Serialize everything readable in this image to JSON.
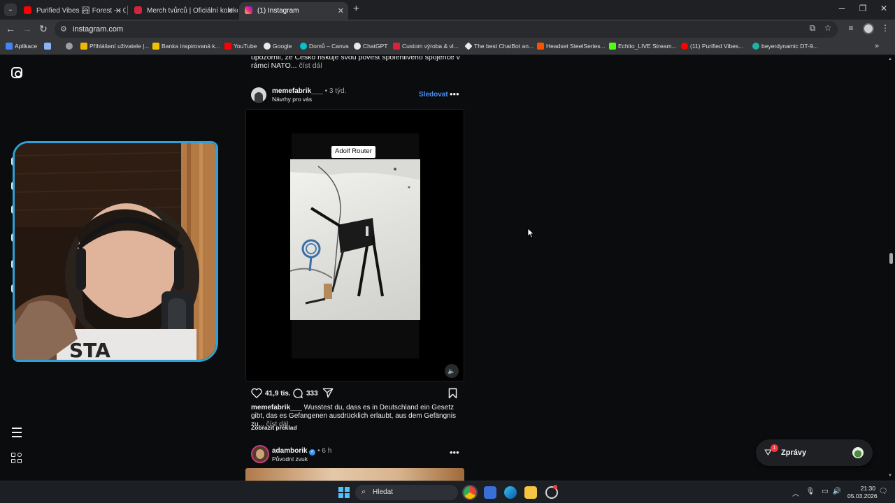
{
  "browser": {
    "tabs": [
      {
        "title": "Purified Vibes 🏞 Forest — Chi",
        "active": false,
        "favicon_color": "#ff0000"
      },
      {
        "title": "Merch tvůrců | Oficiální kolekce",
        "active": false,
        "favicon_color": "#d6233c"
      },
      {
        "title": "(1) Instagram",
        "active": true,
        "favicon_color": "#e1306c"
      }
    ],
    "url": "instagram.com",
    "bookmarks": [
      {
        "label": "Aplikace",
        "color": "#4285f4"
      },
      {
        "label": "",
        "color": "#8ab4f8"
      },
      {
        "label": "",
        "color": "#9aa0a6"
      },
      {
        "label": "Přihlášení uživatele |...",
        "color": "#f2b705"
      },
      {
        "label": "Banka inspirovaná k...",
        "color": "#f2c200"
      },
      {
        "label": "YouTube",
        "color": "#ff0000"
      },
      {
        "label": "Google",
        "color": "#e8eaed"
      },
      {
        "label": "Domů – Canva",
        "color": "#00c4cc"
      },
      {
        "label": "ChatGPT",
        "color": "#e8eaed"
      },
      {
        "label": "Custom výroba & vl...",
        "color": "#d6233c"
      },
      {
        "label": "The best ChatBot an...",
        "color": "#e8eaed"
      },
      {
        "label": "Headset SteelSeries...",
        "color": "#ff5200"
      },
      {
        "label": "Echito_LIVE Stream...",
        "color": "#53fc18"
      },
      {
        "label": "(11) Purified Vibes...",
        "color": "#ff0000"
      },
      {
        "label": "beyerdynamic DT-9...",
        "color": "#1ab3a6"
      }
    ]
  },
  "feed": {
    "prev_caption": {
      "text": "upozornil, že Česko riskuje svou pověst spolehlivého spojence v rámci NATO...",
      "more": "číst dál"
    },
    "post": {
      "username": "memefabrik___",
      "time": " • 3 týd.",
      "subline": "Návrhy pro vás",
      "follow": "Sledovat",
      "meme_label": "Adolf Router",
      "likes": "41,9 tis.",
      "comments": "333",
      "caption_user": "memefabrik___",
      "caption_text": " Wusstest du, dass es in Deutschland ein Gesetz gibt, das es Gefangenen ausdrücklich erlaubt, aus dem Gefängnis zu...",
      "caption_more": "číst dál",
      "translate": "Zobrazit překlad"
    },
    "post2": {
      "username": "adamborik",
      "verified": "✓",
      "time": " • 6 h",
      "subline": "Původní zvuk"
    }
  },
  "messages": {
    "label": "Zprávy",
    "badge": "1"
  },
  "taskbar": {
    "search_label": "Hledat",
    "time": "21:30",
    "date": "05.03.2026"
  }
}
